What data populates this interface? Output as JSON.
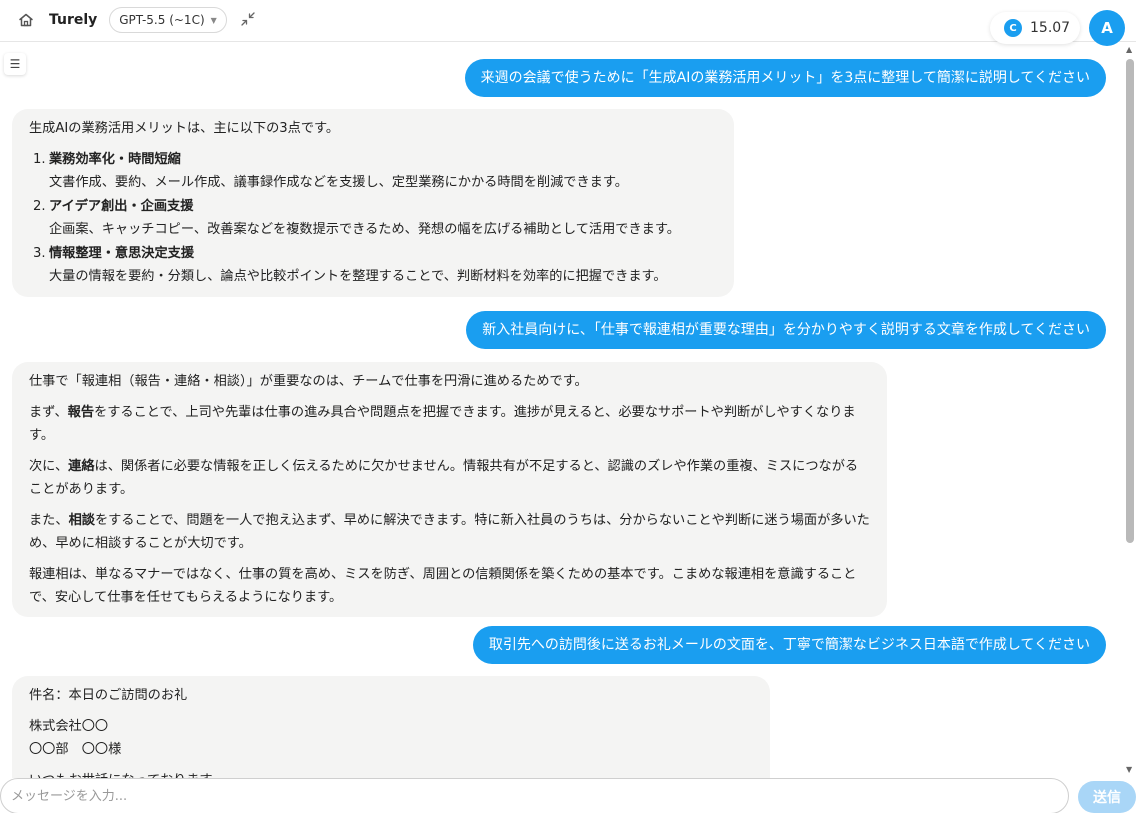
{
  "header": {
    "brand": "Turely",
    "model_selected": "GPT-5.5 (~1C)",
    "credits": "15.07",
    "credit_badge": "C",
    "avatar_initial": "A"
  },
  "chat": {
    "messages": [
      {
        "role": "user",
        "text": "来週の会議で使うために「生成AIの業務活用メリット」を3点に整理して簡潔に説明してください"
      },
      {
        "role": "assistant",
        "intro": "生成AIの業務活用メリットは、主に以下の3点です。",
        "items": [
          {
            "num": "1.",
            "title": "業務効率化・時間短縮",
            "body": "文書作成、要約、メール作成、議事録作成などを支援し、定型業務にかかる時間を削減できます。"
          },
          {
            "num": "2.",
            "title": "アイデア創出・企画支援",
            "body": "企画案、キャッチコピー、改善案などを複数提示できるため、発想の幅を広げる補助として活用できます。"
          },
          {
            "num": "3.",
            "title": "情報整理・意思決定支援",
            "body": "大量の情報を要約・分類し、論点や比較ポイントを整理することで、判断材料を効率的に把握できます。"
          }
        ]
      },
      {
        "role": "user",
        "text": "新入社員向けに、「仕事で報連相が重要な理由」を分かりやすく説明する文章を作成してください"
      },
      {
        "role": "assistant",
        "p1": "仕事で「報連相（報告・連絡・相談）」が重要なのは、チームで仕事を円滑に進めるためです。",
        "p2_pre": "まず、",
        "p2_bold": "報告",
        "p2_post": "をすることで、上司や先輩は仕事の進み具合や問題点を把握できます。進捗が見えると、必要なサポートや判断がしやすくなります。",
        "p3_pre": "次に、",
        "p3_bold": "連絡",
        "p3_post": "は、関係者に必要な情報を正しく伝えるために欠かせません。情報共有が不足すると、認識のズレや作業の重複、ミスにつながることがあります。",
        "p4_pre": "また、",
        "p4_bold": "相談",
        "p4_post": "をすることで、問題を一人で抱え込まず、早めに解決できます。特に新入社員のうちは、分からないことや判断に迷う場面が多いため、早めに相談することが大切です。",
        "p5": "報連相は、単なるマナーではなく、仕事の質を高め、ミスを防ぎ、周囲との信頼関係を築くための基本です。こまめな報連相を意識することで、安心して仕事を任せてもらえるようになります。"
      },
      {
        "role": "user",
        "text": "取引先への訪問後に送るお礼メールの文面を、丁寧で簡潔なビジネス日本語で作成してください"
      },
      {
        "role": "assistant",
        "line1": "件名：本日のご訪問のお礼",
        "line2": "株式会社〇〇",
        "line3": "〇〇部　〇〇様",
        "line4": "いつもお世話になっております。"
      }
    ]
  },
  "composer": {
    "placeholder": "メッセージを入力...",
    "send_label": "送信"
  }
}
